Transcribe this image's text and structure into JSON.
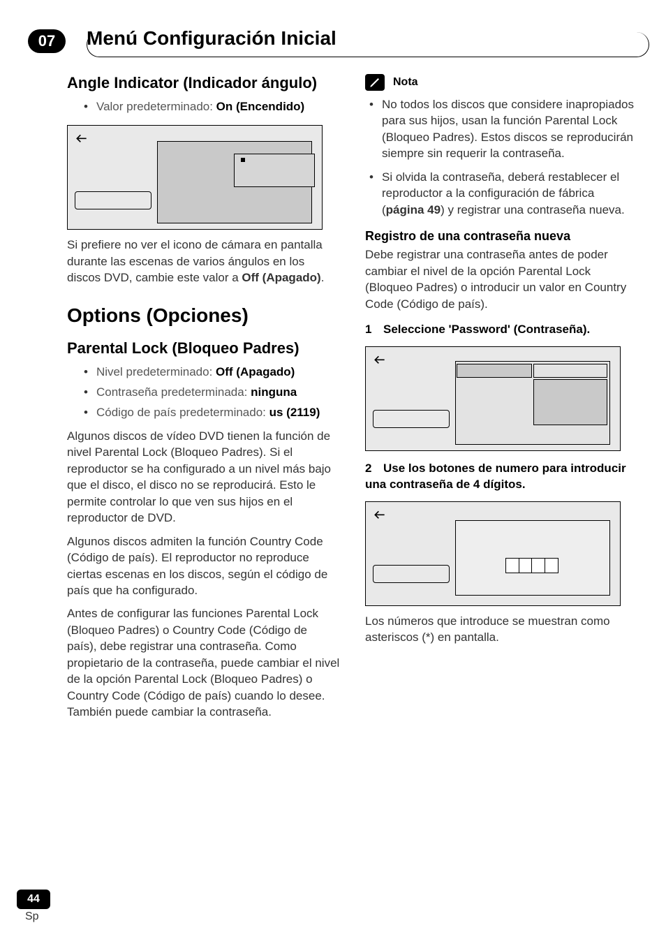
{
  "chapter": {
    "number": "07",
    "title": "Menú Configuración Inicial"
  },
  "left": {
    "angle": {
      "heading": "Angle Indicator (Indicador ángulo)",
      "bullet_label": "Valor predeterminado: ",
      "bullet_value": "On (Encendido)",
      "para_before": "Si prefiere no ver el icono de cámara en pantalla durante las escenas de varios ángulos en los discos DVD, cambie este valor a ",
      "para_bold": "Off (Apagado)",
      "para_after": "."
    },
    "options_heading": "Options (Opciones)",
    "parental": {
      "heading": "Parental Lock (Bloqueo Padres)",
      "b1_label": "Nivel predeterminado: ",
      "b1_value": "Off (Apagado)",
      "b2_label": "Contraseña predeterminada: ",
      "b2_value": "ninguna",
      "b3_label": "Código de país predeterminado: ",
      "b3_value": "us (2119)",
      "p1": "Algunos discos de vídeo DVD tienen la función de nivel Parental Lock (Bloqueo Padres). Si el reproductor se ha configurado a un nivel más bajo que el disco, el disco no se reproducirá. Esto le permite controlar lo que ven sus hijos en el reproductor de DVD.",
      "p2": "Algunos discos admiten la función Country Code (Código de país). El reproductor no reproduce ciertas escenas en los discos, según el código de país que ha configurado.",
      "p3": "Antes de configurar las funciones Parental Lock (Bloqueo Padres) o Country Code (Código de país), debe registrar una contraseña. Como propietario de la contraseña, puede cambiar el nivel de la opción Parental Lock (Bloqueo Padres) o Country Code (Código de país) cuando lo desee. También puede cambiar la contraseña."
    }
  },
  "right": {
    "note_label": "Nota",
    "note1": "No todos los discos que considere inapropiados para sus hijos, usan la función Parental Lock (Bloqueo Padres). Estos discos se reproducirán siempre sin requerir la contraseña.",
    "note2_before": "Si olvida la contraseña, deberá restablecer el reproductor a la configuración de fábrica (",
    "note2_bold": "página 49",
    "note2_after": ") y registrar una contraseña nueva.",
    "reg_heading": "Registro de una contraseña nueva",
    "reg_para": "Debe registrar una contraseña antes de poder cambiar el nivel de la opción Parental Lock (Bloqueo Padres) o introducir un valor en Country Code (Código de país).",
    "step1_num": "1",
    "step1_text": "Seleccione 'Password' (Contraseña).",
    "step2_num": "2",
    "step2_text": "Use los botones de numero para introducir una contraseña de 4 dígitos.",
    "closing": "Los números que introduce se muestran como asteriscos (*) en pantalla."
  },
  "footer": {
    "page": "44",
    "lang": "Sp"
  }
}
